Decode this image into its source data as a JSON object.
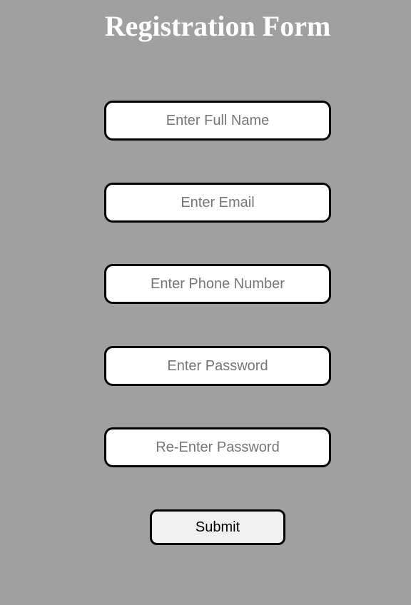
{
  "page": {
    "title": "Registration Form",
    "background_color": "#a0a0a0"
  },
  "form": {
    "fields": [
      {
        "name": "full-name",
        "type": "text",
        "value": "",
        "placeholder": "Enter Full Name"
      },
      {
        "name": "email",
        "type": "email",
        "value": "",
        "placeholder": "Enter Email"
      },
      {
        "name": "phone",
        "type": "tel",
        "value": "",
        "placeholder": "Enter Phone Number"
      },
      {
        "name": "password",
        "type": "password",
        "value": "",
        "placeholder": "Enter Password"
      },
      {
        "name": "re-password",
        "type": "password",
        "value": "",
        "placeholder": "Re-Enter Password"
      }
    ],
    "submit_label": "Submit"
  },
  "colors": {
    "field_background": "#ffffff",
    "field_border": "#000000",
    "placeholder_text": "#757575",
    "button_background": "#f0f0f0",
    "title_text": "#ffffff"
  }
}
